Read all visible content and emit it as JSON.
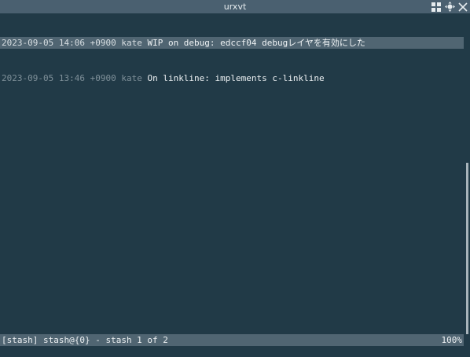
{
  "window": {
    "title": "urxvt",
    "controls": [
      "tile-icon",
      "move-icon",
      "close-icon"
    ]
  },
  "log": [
    {
      "date": "2023-09-05 14:06 +0900",
      "author": "kate",
      "subject": "WIP on debug: edccf04 debugレイヤを有効にした",
      "selected": true
    },
    {
      "date": "2023-09-05 13:46 +0900",
      "author": "kate",
      "subject": "On linkline: implements c-linkline",
      "selected": false
    }
  ],
  "statusbar": {
    "left": "[stash] stash@{0} - stash 1 of 2",
    "right": "100%"
  },
  "colors": {
    "background": "#213a47",
    "selection": "#506572",
    "titlebar": "#4a6070"
  }
}
